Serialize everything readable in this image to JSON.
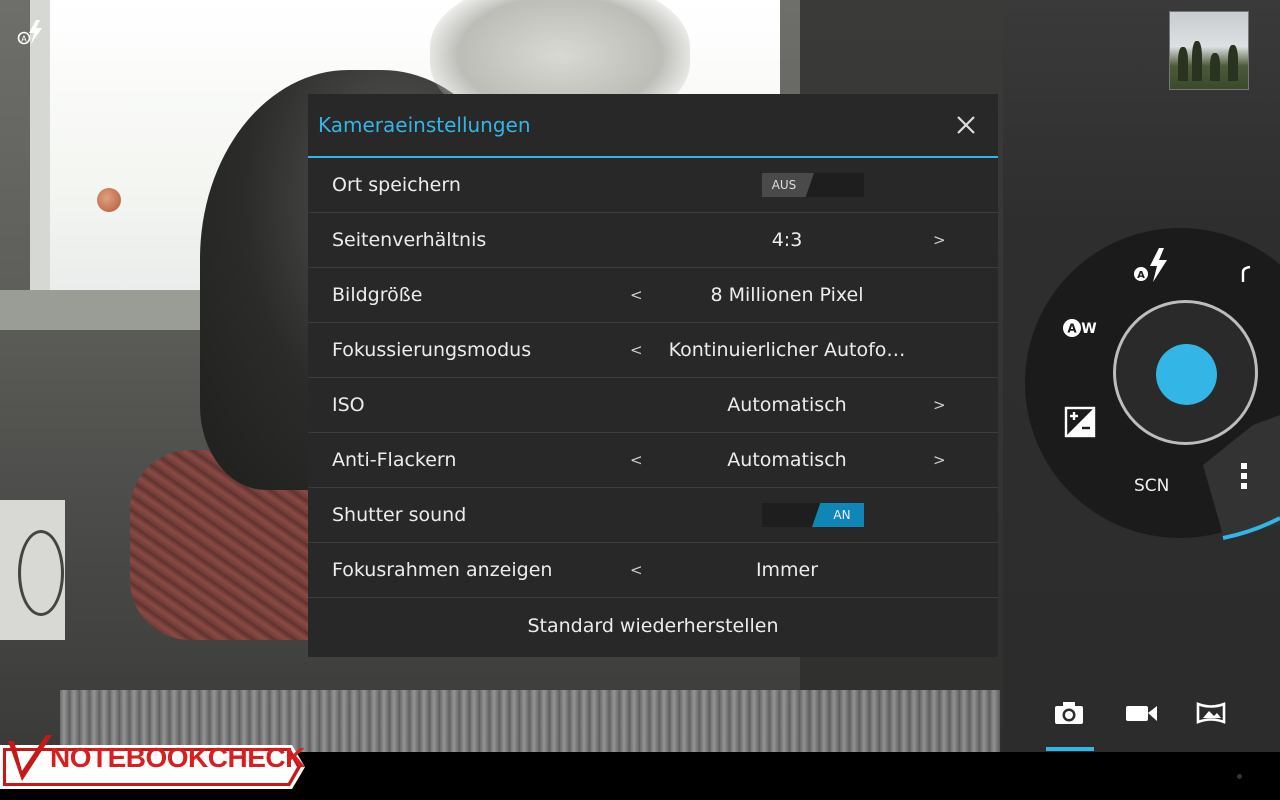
{
  "dialog": {
    "title": "Kameraeinstellungen",
    "rows": [
      {
        "label": "Ort speichern",
        "toggle": "AUS"
      },
      {
        "label": "Seitenverhältnis",
        "value": "4:3"
      },
      {
        "label": "Bildgröße",
        "value": "8 Millionen Pixel"
      },
      {
        "label": "Fokussierungsmodus",
        "value": "Kontinuierlicher Autofo…"
      },
      {
        "label": "ISO",
        "value": "Automatisch"
      },
      {
        "label": "Anti-Flackern",
        "value": "Automatisch"
      },
      {
        "label": "Shutter sound",
        "toggle": "AN"
      },
      {
        "label": "Fokusrahmen anzeigen",
        "value": "Immer"
      }
    ],
    "reset_label": "Standard wiederherstellen",
    "arrow_left": "<",
    "arrow_right": ">"
  },
  "camera": {
    "scene_label": "SCN",
    "icons": [
      "flash-auto-icon",
      "white-balance-auto-icon",
      "exposure-icon",
      "more-icon",
      "camera-icon",
      "video-icon",
      "panorama-icon"
    ]
  },
  "brand": {
    "part1": "NOTEBOOK",
    "part2": "CHECK"
  },
  "colors": {
    "accent": "#33b5e5",
    "dialog_bg": "#282828",
    "toggle_on": "#0e86b8"
  }
}
